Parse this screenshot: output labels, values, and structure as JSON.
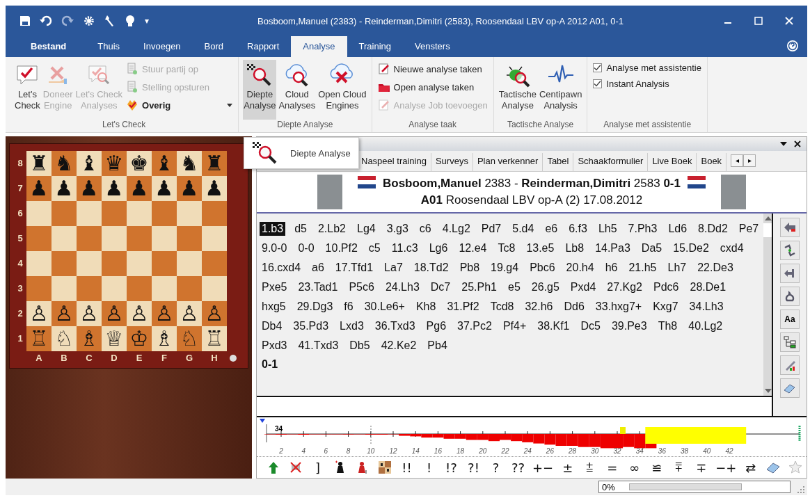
{
  "window": {
    "title": "Bosboom,Manuel (2383) - Reinderman,Dimitri (2583), Roosendaal LBV op-A 2012  A01, 0-1",
    "quick_access_more": "▾"
  },
  "ribbon": {
    "tabs": [
      {
        "label": "Bestand",
        "selected": false,
        "kind": "file"
      },
      {
        "label": "Thuis",
        "selected": false,
        "kind": "tab"
      },
      {
        "label": "Invoegen",
        "selected": false,
        "kind": "tab"
      },
      {
        "label": "Bord",
        "selected": false,
        "kind": "tab"
      },
      {
        "label": "Rapport",
        "selected": false,
        "kind": "tab"
      },
      {
        "label": "Analyse",
        "selected": true,
        "kind": "tab"
      },
      {
        "label": "Training",
        "selected": false,
        "kind": "tab"
      },
      {
        "label": "Vensters",
        "selected": false,
        "kind": "tab"
      }
    ],
    "groups": [
      {
        "title": "Let's Check",
        "large_buttons": [
          {
            "label": "Let's\nCheck",
            "disabled": false,
            "pressed": false
          },
          {
            "label": "Doneer\nEngine",
            "disabled": true,
            "pressed": false
          },
          {
            "label": "Let's Check\nAnalyses",
            "disabled": true,
            "pressed": false
          }
        ],
        "small_buttons": [
          {
            "label": "Stuur partij op",
            "disabled": true,
            "has_dropdown": false
          },
          {
            "label": "Stelling opsturen",
            "disabled": true,
            "has_dropdown": false
          },
          {
            "label": "Overig",
            "disabled": false,
            "has_dropdown": true
          }
        ]
      },
      {
        "title": "Diepte Analyse",
        "large_buttons": [
          {
            "label": "Diepte\nAnalyse",
            "disabled": false,
            "pressed": true
          },
          {
            "label": "Cloud\nAnalyses",
            "disabled": false,
            "pressed": false
          },
          {
            "label": "Open Cloud\nEngines",
            "disabled": false,
            "pressed": false
          }
        ]
      },
      {
        "title": "Analyse taak",
        "small_buttons": [
          {
            "label": "Nieuwe analyse taken",
            "disabled": false,
            "has_dropdown": false
          },
          {
            "label": "Open analyse taken",
            "disabled": false,
            "has_dropdown": false
          },
          {
            "label": "Analyse Job toevoegen",
            "disabled": true,
            "has_dropdown": false
          }
        ]
      },
      {
        "title": "Tactische Analyse",
        "large_buttons": [
          {
            "label": "Tactische\nAnalyse",
            "disabled": false,
            "pressed": false
          },
          {
            "label": "Centipawn\nAnalysis",
            "disabled": false,
            "pressed": false
          }
        ]
      },
      {
        "title": "Analyse met assistentie",
        "checkboxes": [
          {
            "label": "Analyse met assistentie",
            "checked": true
          },
          {
            "label": "Instant Analysis",
            "checked": true
          }
        ]
      }
    ]
  },
  "tooltip": {
    "label": "Diepte Analyse"
  },
  "board": {
    "ranks": [
      "8",
      "7",
      "6",
      "5",
      "4",
      "3",
      "2",
      "1"
    ],
    "files": [
      "A",
      "B",
      "C",
      "D",
      "E",
      "F",
      "G",
      "H"
    ],
    "rows": [
      [
        "♜",
        "♞",
        "♝",
        "♛",
        "♚",
        "♝",
        "♞",
        "♜"
      ],
      [
        "♟",
        "♟",
        "♟",
        "♟",
        "♟",
        "♟",
        "♟",
        "♟"
      ],
      [
        null,
        null,
        null,
        null,
        null,
        null,
        null,
        null
      ],
      [
        null,
        null,
        null,
        null,
        null,
        null,
        null,
        null
      ],
      [
        null,
        null,
        null,
        null,
        null,
        null,
        null,
        null
      ],
      [
        null,
        null,
        null,
        null,
        null,
        null,
        null,
        null
      ],
      [
        "♙",
        "♙",
        "♙",
        "♙",
        "♙",
        "♙",
        "♙",
        "♙"
      ],
      [
        "♖",
        "♘",
        "♗",
        "♕",
        "♔",
        "♗",
        "♘",
        "♖"
      ]
    ]
  },
  "panel": {
    "tabs": [
      {
        "label": "Naspeel training",
        "selected": false
      },
      {
        "label": "Surveys",
        "selected": false
      },
      {
        "label": "Plan verkenner",
        "selected": false
      },
      {
        "label": "Tabel",
        "selected": false
      },
      {
        "label": "Schaakformulier",
        "selected": false
      },
      {
        "label": "Live Boek",
        "selected": false
      },
      {
        "label": "Boek",
        "selected": false
      }
    ],
    "tab_scroll": [
      "◂",
      "▸"
    ],
    "game_header": {
      "players_line": "**Bosboom,Manuel** 2383 - **Reinderman,Dimitri** 2583  **0-1**",
      "event_line": "**A01** Roosendaal LBV op-A (2) 17.08.2012"
    },
    "notation": {
      "lines": [
        [
          {
            "text": "1.b3",
            "selected": true
          },
          {
            "text": "d5",
            "selected": false
          },
          {
            "text": "2.Lb2",
            "selected": false
          },
          {
            "text": "Lg4",
            "selected": false
          },
          {
            "text": "3.g3",
            "selected": false
          },
          {
            "text": "c6",
            "selected": false
          },
          {
            "text": "4.Lg2",
            "selected": false
          },
          {
            "text": "Pd7",
            "selected": false
          },
          {
            "text": "5.d4",
            "selected": false
          },
          {
            "text": "e6",
            "selected": false
          },
          {
            "text": "6.f3",
            "selected": false
          },
          {
            "text": "Lh5",
            "selected": false
          },
          {
            "text": "7.Ph3",
            "selected": false
          },
          {
            "text": "Ld6",
            "selected": false
          },
          {
            "text": "8.Dd2",
            "selected": false
          },
          {
            "text": "Pe7",
            "selected": false
          }
        ],
        [
          {
            "text": "9.0-0",
            "selected": false
          },
          {
            "text": "0-0",
            "selected": false
          },
          {
            "text": "10.Pf2",
            "selected": false
          },
          {
            "text": "c5",
            "selected": false
          },
          {
            "text": "11.c3",
            "selected": false
          },
          {
            "text": "Lg6",
            "selected": false
          },
          {
            "text": "12.e4",
            "selected": false
          },
          {
            "text": "Tc8",
            "selected": false
          },
          {
            "text": "13.e5",
            "selected": false
          },
          {
            "text": "Lb8",
            "selected": false
          },
          {
            "text": "14.Pa3",
            "selected": false
          },
          {
            "text": "Da5",
            "selected": false
          },
          {
            "text": "15.De2",
            "selected": false
          },
          {
            "text": "cxd4",
            "selected": false
          }
        ],
        [
          {
            "text": "16.cxd4",
            "selected": false
          },
          {
            "text": "a6",
            "selected": false
          },
          {
            "text": "17.Tfd1",
            "selected": false
          },
          {
            "text": "La7",
            "selected": false
          },
          {
            "text": "18.Td2",
            "selected": false
          },
          {
            "text": "Pb8",
            "selected": false
          },
          {
            "text": "19.g4",
            "selected": false
          },
          {
            "text": "Pbc6",
            "selected": false
          },
          {
            "text": "20.h4",
            "selected": false
          },
          {
            "text": "h6",
            "selected": false
          },
          {
            "text": "21.h5",
            "selected": false
          },
          {
            "text": "Lh7",
            "selected": false
          },
          {
            "text": "22.De3",
            "selected": false
          }
        ],
        [
          {
            "text": "Pxe5",
            "selected": false
          },
          {
            "text": "23.Tad1",
            "selected": false
          },
          {
            "text": "P5c6",
            "selected": false
          },
          {
            "text": "24.Lh3",
            "selected": false
          },
          {
            "text": "Dc7",
            "selected": false
          },
          {
            "text": "25.Ph1",
            "selected": false
          },
          {
            "text": "e5",
            "selected": false
          },
          {
            "text": "26.g5",
            "selected": false
          },
          {
            "text": "Pxd4",
            "selected": false
          },
          {
            "text": "27.Kg2",
            "selected": false
          },
          {
            "text": "Pdc6",
            "selected": false
          },
          {
            "text": "28.De1",
            "selected": false
          }
        ],
        [
          {
            "text": "hxg5",
            "selected": false
          },
          {
            "text": "29.Dg3",
            "selected": false
          },
          {
            "text": "f6",
            "selected": false
          },
          {
            "text": "30.Le6+",
            "selected": false
          },
          {
            "text": "Kh8",
            "selected": false
          },
          {
            "text": "31.Pf2",
            "selected": false
          },
          {
            "text": "Tcd8",
            "selected": false
          },
          {
            "text": "32.h6",
            "selected": false
          },
          {
            "text": "Dd6",
            "selected": false
          },
          {
            "text": "33.hxg7+",
            "selected": false
          },
          {
            "text": "Kxg7",
            "selected": false
          },
          {
            "text": "34.Lh3",
            "selected": false
          }
        ],
        [
          {
            "text": "Db4",
            "selected": false
          },
          {
            "text": "35.Pd3",
            "selected": false
          },
          {
            "text": "Lxd3",
            "selected": false
          },
          {
            "text": "36.Txd3",
            "selected": false
          },
          {
            "text": "Pg6",
            "selected": false
          },
          {
            "text": "37.Pc2",
            "selected": false
          },
          {
            "text": "Pf4+",
            "selected": false
          },
          {
            "text": "38.Kf1",
            "selected": false
          },
          {
            "text": "Dc5",
            "selected": false
          },
          {
            "text": "39.Pe3",
            "selected": false
          },
          {
            "text": "Th8",
            "selected": false
          },
          {
            "text": "40.Lg2",
            "selected": false
          }
        ],
        [
          {
            "text": "Pxd3",
            "selected": false
          },
          {
            "text": "41.Txd3",
            "selected": false
          },
          {
            "text": "Db5",
            "selected": false
          },
          {
            "text": "42.Ke2",
            "selected": false
          },
          {
            "text": "Pb4",
            "selected": false
          }
        ]
      ],
      "result": "0-1"
    },
    "side_toolbar_font_label": "Aa",
    "eval_graph": {
      "move_marker": "34",
      "move_labels": [
        "2",
        "4",
        "6",
        "8",
        "10",
        "12",
        "14",
        "16",
        "18",
        "20",
        "22",
        "24",
        "26",
        "28",
        "30",
        "32",
        "34",
        "36",
        "38",
        "40",
        "42"
      ]
    },
    "annotation_symbols": [
      "]",
      "!!",
      "!",
      "!?",
      "?!",
      "?",
      "??",
      "+−",
      "±",
      "⩲",
      "=",
      "∞",
      "≌",
      "⩱",
      "∓",
      "−+",
      "⇄"
    ]
  },
  "status_bar": {
    "progress_text": "0%",
    "progress": {
      "level": 0
    }
  }
}
